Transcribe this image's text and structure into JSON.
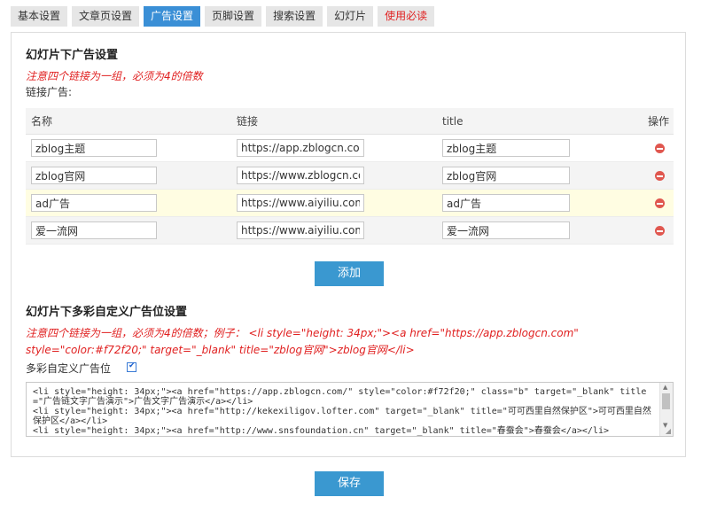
{
  "tabs": [
    {
      "label": "基本设置",
      "state": "normal"
    },
    {
      "label": "文章页设置",
      "state": "normal"
    },
    {
      "label": "广告设置",
      "state": "active"
    },
    {
      "label": "页脚设置",
      "state": "normal"
    },
    {
      "label": "搜索设置",
      "state": "normal"
    },
    {
      "label": "幻灯片",
      "state": "normal"
    },
    {
      "label": "使用必读",
      "state": "warning"
    }
  ],
  "section1": {
    "title": "幻灯片下广告设置",
    "note": "注意四个链接为一组，必须为4的倍数",
    "label": "链接广告:",
    "columns": {
      "name": "名称",
      "link": "链接",
      "title": "title",
      "action": "操作"
    },
    "rows": [
      {
        "name": "zblog主题",
        "link": "https://app.zblogcn.com",
        "title": "zblog主题"
      },
      {
        "name": "zblog官网",
        "link": "https://www.zblogcn.com",
        "title": "zblog官网"
      },
      {
        "name": "ad广告",
        "link": "https://www.aiyiliu.com",
        "title": "ad广告"
      },
      {
        "name": "爱一流网",
        "link": "https://www.aiyiliu.com",
        "title": "爱一流网"
      }
    ],
    "add_label": "添加"
  },
  "section2": {
    "title": "幻灯片下多彩自定义广告位设置",
    "note": "注意四个链接为一组，必须为4的倍数；例子： <li style=\"height: 34px;\"><a href=\"https://app.zblogcn.com\" style=\"color:#f72f20;\" target=\"_blank\" title=\"zblog官网\">zblog官网</li>",
    "checkbox_label": "多彩自定义广告位",
    "checkbox_checked": true,
    "code": "<li style=\"height: 34px;\"><a href=\"https://app.zblogcn.com/\" style=\"color:#f72f20;\" class=\"b\" target=\"_blank\" title=\"广告链文字广告演示\">广告文字广告演示</a></li>\n<li style=\"height: 34px;\"><a href=\"http://kekexiligov.lofter.com\" target=\"_blank\" title=\"可可西里自然保护区\">可可西里自然保护区</a></li>\n<li style=\"height: 34px;\"><a href=\"http://www.snsfoundation.cn\" target=\"_blank\" title=\"春蚕会\">春蚕会</a></li>"
  },
  "save_label": "保存",
  "colors": {
    "tab_active": "#3a8fd6",
    "button": "#3a98d0",
    "warning_text": "#e02020",
    "delete_icon": "#e0574f"
  }
}
